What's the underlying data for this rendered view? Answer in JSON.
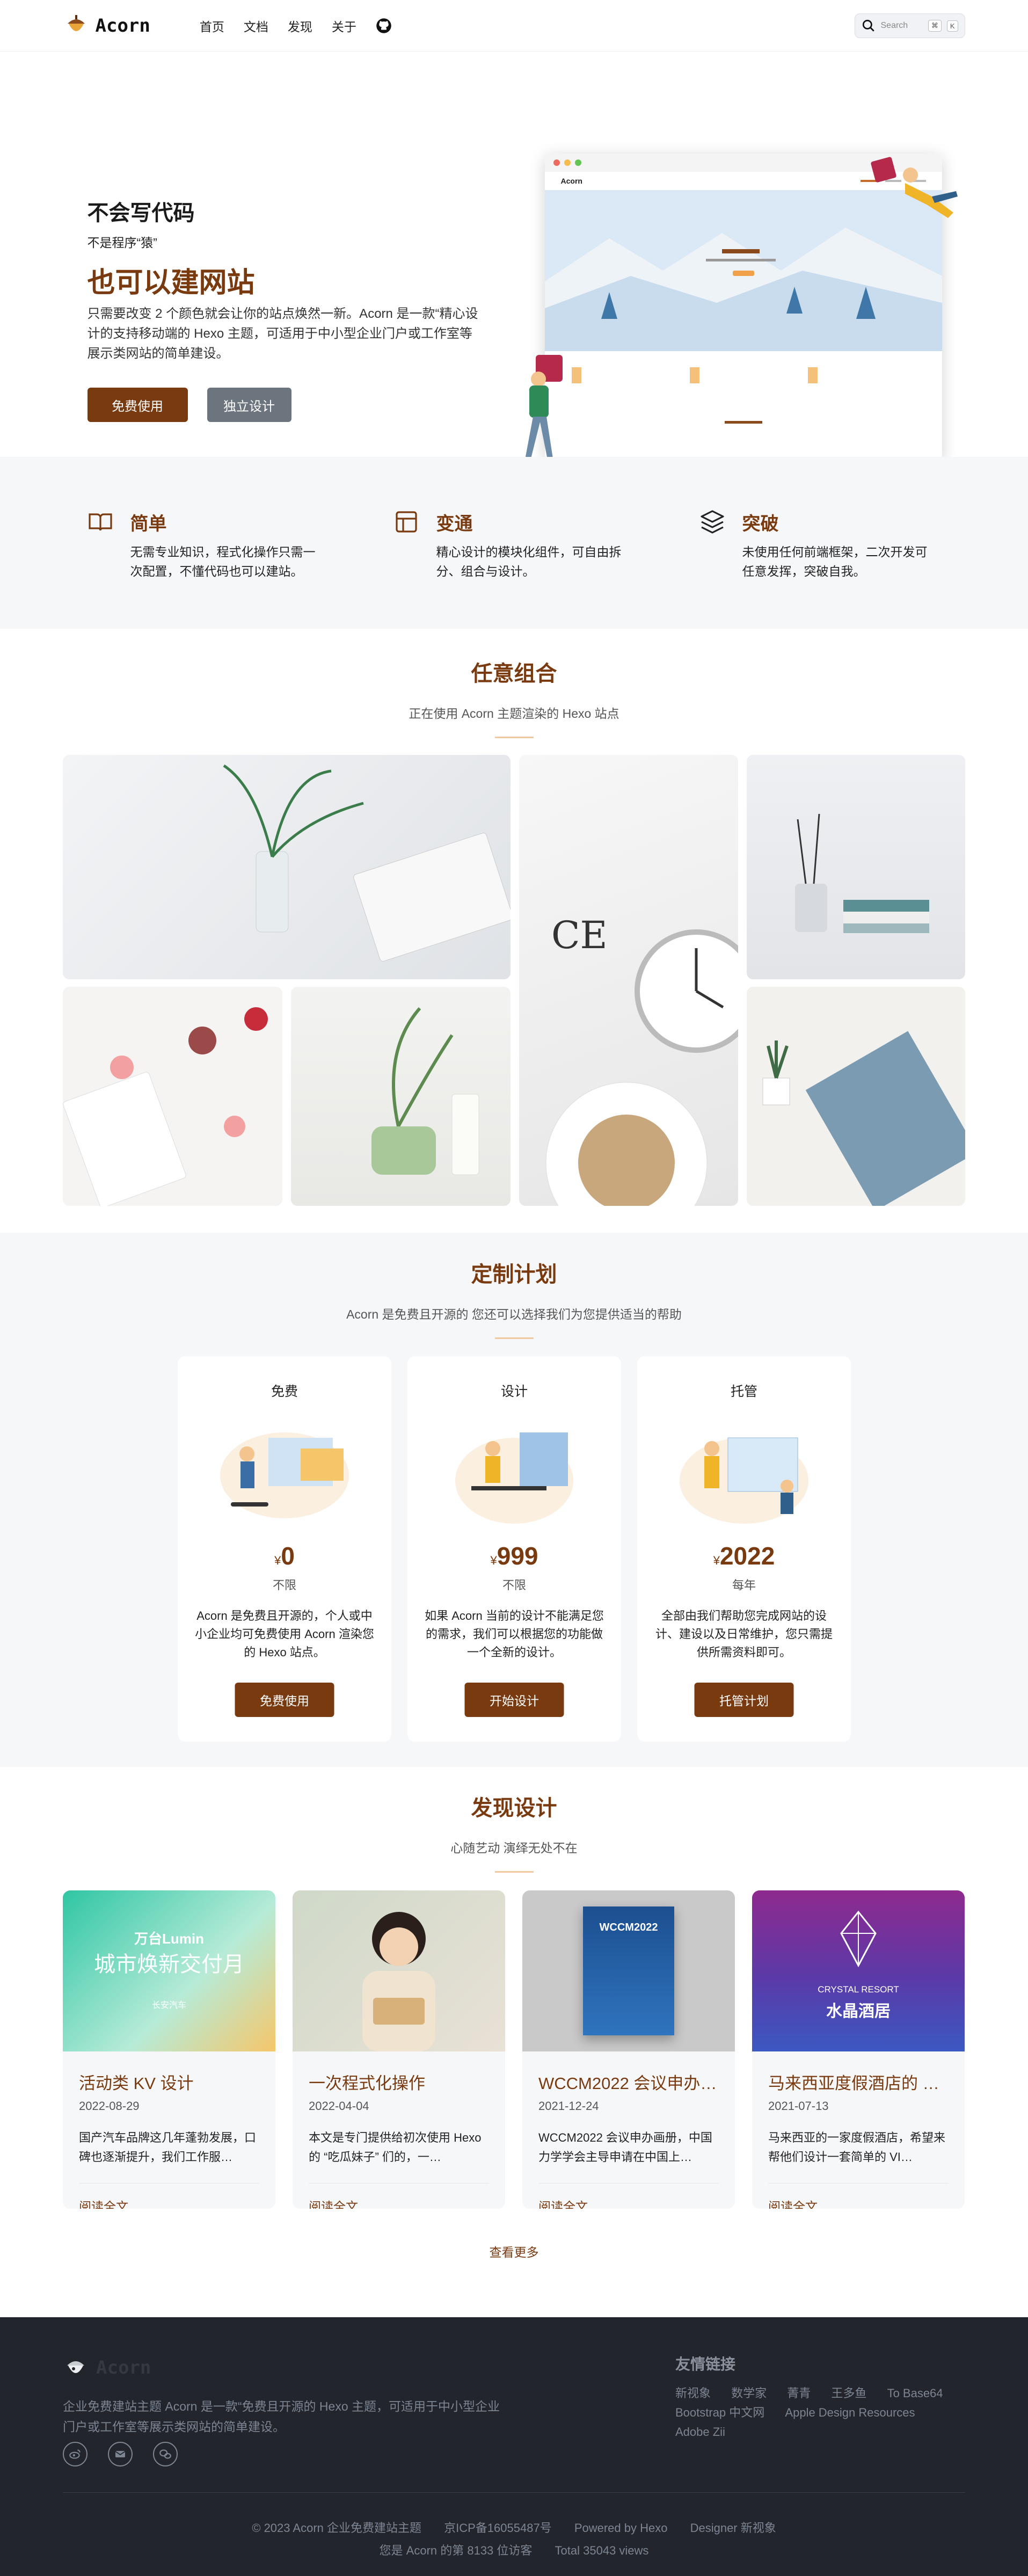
{
  "nav": {
    "brand": "Acorn",
    "items": [
      "首页",
      "文档",
      "发现",
      "关于"
    ],
    "search_placeholder": "Search",
    "search_keys": [
      "⌘",
      "K"
    ]
  },
  "hero": {
    "title_small": "不会写代码",
    "tagline": "不是程序“猿”",
    "title_big": "也可以建网站",
    "desc": "只需要改变 2 个颜色就会让你的站点焕然一新。Acorn 是一款“精心设计的支持移动端的 Hexo 主题，可适用于中小型企业门户或工作室等展示类网站的简单建设。",
    "btn_primary": "免费使用",
    "btn_secondary": "独立设计",
    "mock_brand": "Acorn"
  },
  "features": [
    {
      "icon": "book-icon",
      "title": "简单",
      "desc": "无需专业知识，程式化操作只需一次配置，不懂代码也可以建站。"
    },
    {
      "icon": "layout-icon",
      "title": "变通",
      "desc": "精心设计的模块化组件，可自由拆分、组合与设计。"
    },
    {
      "icon": "layers-icon",
      "title": "突破",
      "desc": "未使用任何前端框架，二次开发可任意发挥，突破自我。"
    }
  ],
  "gallery": {
    "title": "任意组合",
    "subtitle": "正在使用 Acorn 主题渲染的 Hexo 站点"
  },
  "pricing": {
    "title": "定制计划",
    "subtitle": "Acorn 是免费且开源的 您还可以选择我们为您提供适当的帮助",
    "plans": [
      {
        "name": "免费",
        "currency": "¥",
        "price": "0",
        "period": "不限",
        "desc": "Acorn 是免费且开源的，个人或中小企业均可免费使用 Acorn 渲染您的 Hexo 站点。",
        "button": "免费使用"
      },
      {
        "name": "设计",
        "currency": "¥",
        "price": "999",
        "period": "不限",
        "desc": "如果 Acorn 当前的设计不能满足您的需求，我们可以根据您的功能做一个全新的设计。",
        "button": "开始设计"
      },
      {
        "name": "托管",
        "currency": "¥",
        "price": "2022",
        "period": "每年",
        "desc": "全部由我们帮助您完成网站的设计、建设以及日常维护，您只需提供所需资料即可。",
        "button": "托管计划"
      }
    ]
  },
  "discover": {
    "title": "发现设计",
    "subtitle": "心随艺动 演绎无处不在",
    "posts": [
      {
        "title": "活动类 KV 设计",
        "date": "2022-08-29",
        "excerpt": "国产汽车品牌这几年蓬勃发展，口碑也逐渐提升，我们工作服…",
        "read": "阅读全文",
        "img_text": [
          "万台Lumin",
          "城市焕新交付月",
          "长安汽车"
        ]
      },
      {
        "title": "一次程式化操作",
        "date": "2022-04-04",
        "excerpt": "本文是专门提供给初次使用 Hexo 的 “吃瓜妹子” 们的，一…",
        "read": "阅读全文",
        "img_text": []
      },
      {
        "title": "WCCM2022 会议申办…",
        "date": "2021-12-24",
        "excerpt": "WCCM2022 会议申办画册，中国力学学会主导申请在中国上…",
        "read": "阅读全文",
        "img_text": [
          "WCCM2022"
        ]
      },
      {
        "title": "马来西亚度假酒店的 VI…",
        "date": "2021-07-13",
        "excerpt": "马来西亚的一家度假酒店，希望来帮他们设计一套简单的 VI…",
        "read": "阅读全文",
        "img_text": [
          "CRYSTAL RESORT",
          "水晶酒居"
        ]
      }
    ],
    "more": "查看更多"
  },
  "footer": {
    "brand": "Acorn",
    "desc": "企业免费建站主题 Acorn 是一款“免费且开源的 Hexo 主题，可适用于中小型企业门户或工作室等展示类网站的简单建设。",
    "social": [
      "weibo-icon",
      "mail-icon",
      "wechat-icon"
    ],
    "links_title": "友情链接",
    "links": [
      "新视象",
      "数学家",
      "菁青",
      "王多鱼",
      "To Base64",
      "Bootstrap 中文网",
      "Apple Design Resources",
      "Adobe Zii"
    ],
    "copyright": [
      "© 2023 Acorn 企业免费建站主题",
      "京ICP备16055487号",
      "Powered by Hexo",
      "Designer 新视象"
    ],
    "stats": [
      "您是 Acorn 的第 8133 位访客",
      "Total 35043 views"
    ]
  },
  "colors": {
    "accent": "#7a3a10",
    "footer_bg": "#22252b",
    "section_bg": "#f6f7f9"
  }
}
